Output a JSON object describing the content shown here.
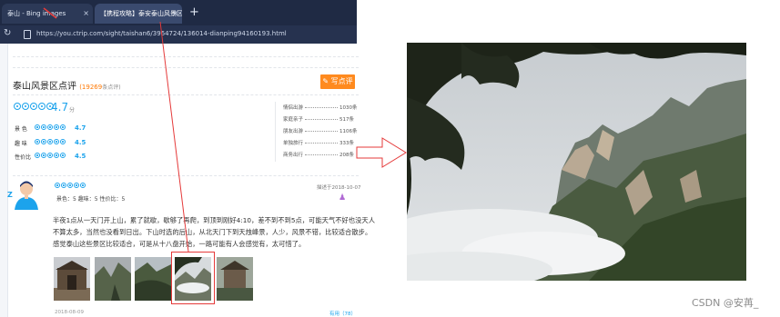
{
  "browser": {
    "tabs": [
      {
        "label": "泰山 - Bing images"
      },
      {
        "label": "【携程攻略】泰安泰山风景区景"
      }
    ],
    "new_tab": "+",
    "tab_close": "×",
    "url": "https://you.ctrip.com/sight/taishan6/3964724/136014-dianping94160193.html"
  },
  "review": {
    "title": "泰山风景区点评",
    "count": "(19269",
    "count_unit": "条点评)",
    "write_button": "写点评",
    "overall_score": "4.7",
    "overall_unit": "分",
    "sub_scores": [
      {
        "label": "景  色",
        "value": "4.7"
      },
      {
        "label": "趣  味",
        "value": "4.5"
      },
      {
        "label": "性价比",
        "value": "4.5"
      }
    ],
    "stats": [
      {
        "label": "情侣出游",
        "value": "1030条"
      },
      {
        "label": "家庭亲子",
        "value": "517条"
      },
      {
        "label": "朋友出游",
        "value": "1106条"
      },
      {
        "label": "单独旅行",
        "value": "333条"
      },
      {
        "label": "商务出行",
        "value": "208条"
      }
    ],
    "item_meta": "景色：5   趣味：5   性价比：5",
    "item_right": "描述于2018-10-07",
    "item_text": [
      "半夜1点从一天门开上山，累了就歇，歇够了再爬，到顶到刚好4:10，差不到不到5点，可能天气不好也没天人",
      "不算太多，当然也没看到日出。下山时选的后山，从北天门下到天烛峰景，人少，风景不错，比较适合散步。",
      "感觉泰山这些景区比较适合，可是从十八盘开始，一路可能有人会感觉有，太可惜了。"
    ],
    "footer_date": "2018-08-09",
    "footer_useful": "有用（78）"
  },
  "watermark": "CSDN @安苒_",
  "colors": {
    "accent_blue": "#1ca3ec",
    "orange": "#ff8a1e",
    "annotation_red": "#e53a3a"
  }
}
